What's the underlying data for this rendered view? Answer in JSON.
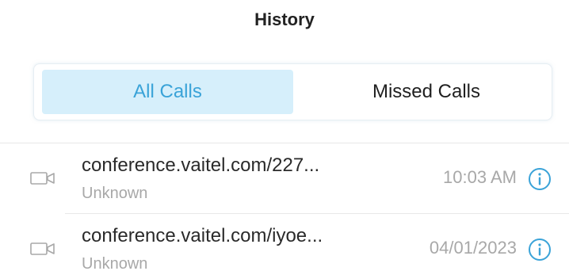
{
  "header": {
    "title": "History"
  },
  "tabs": [
    {
      "label": "All Calls",
      "active": true
    },
    {
      "label": "Missed Calls",
      "active": false
    }
  ],
  "calls": [
    {
      "name": "conference.vaitel.com/227...",
      "subtitle": "Unknown",
      "time": "10:03 AM",
      "icon": "video-camera-icon"
    },
    {
      "name": "conference.vaitel.com/iyoe...",
      "subtitle": "Unknown",
      "time": "04/01/2023",
      "icon": "video-camera-icon"
    }
  ],
  "colors": {
    "accent": "#3aa3d8",
    "active_tab_bg": "#d6effb",
    "secondary_text": "#a8a8a8"
  }
}
